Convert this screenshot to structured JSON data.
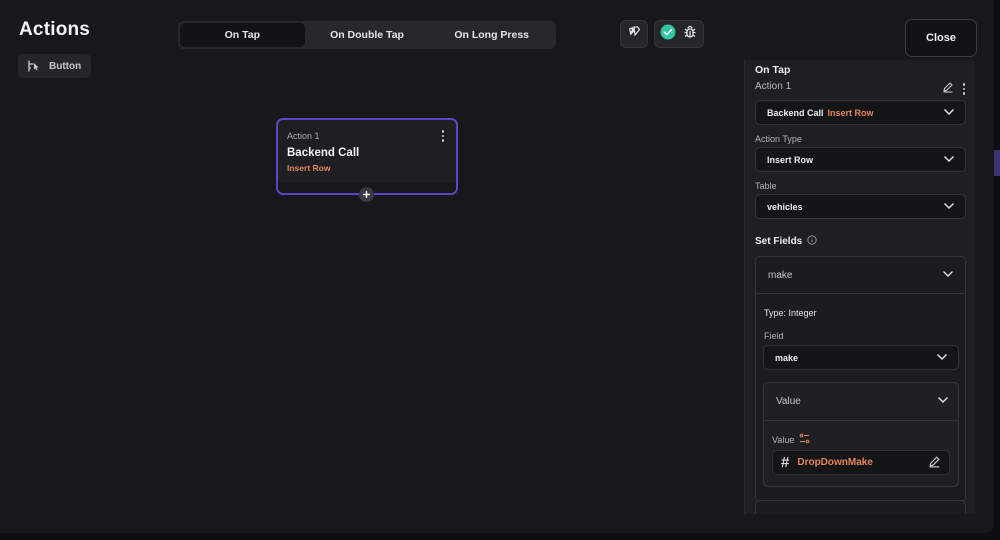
{
  "header": {
    "title": "Actions",
    "widget_label": "Button",
    "close_label": "Close"
  },
  "tabs": [
    {
      "label": "On Tap",
      "active": true
    },
    {
      "label": "On Double Tap",
      "active": false
    },
    {
      "label": "On Long Press",
      "active": false
    }
  ],
  "node": {
    "subtitle": "Action 1",
    "name": "Backend Call",
    "operation": "Insert Row"
  },
  "panel": {
    "trigger": "On Tap",
    "action_title": "Action 1",
    "action_select": {
      "name": "Backend Call",
      "operation": "Insert Row"
    },
    "action_type": {
      "label": "Action Type",
      "value": "Insert Row"
    },
    "table": {
      "label": "Table",
      "value": "vehicles"
    },
    "set_fields": {
      "label": "Set Fields",
      "field_name": "make",
      "type_text": "Type: Integer",
      "field_label": "Field",
      "field_value": "make",
      "value_section": "Value",
      "value_label": "Value",
      "variable": "DropDownMake"
    }
  },
  "colors": {
    "accent": "#5a47c8",
    "operation": "#e8835a",
    "success": "#34c7a4"
  },
  "icons": [
    "widget-tree-icon",
    "theme-icon",
    "check-icon",
    "bug-icon",
    "edit-icon",
    "more-icon",
    "chevron-down-icon",
    "info-icon",
    "settings-toggle-icon",
    "hash-icon",
    "plus-icon"
  ]
}
